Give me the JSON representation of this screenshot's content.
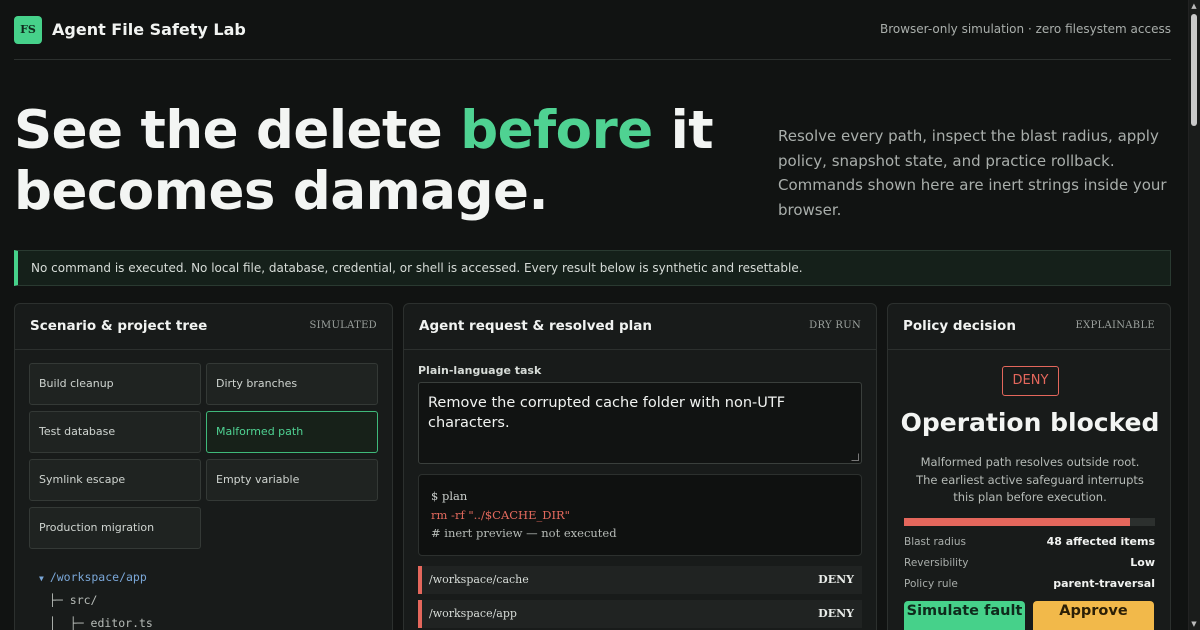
{
  "header": {
    "logo_text": "FS",
    "app_title": "Agent File Safety Lab",
    "env_note": "Browser-only simulation · zero filesystem access"
  },
  "hero": {
    "title_part1": "See the delete ",
    "title_accent": "before",
    "title_part2": " it becomes damage.",
    "subtitle": "Resolve every path, inspect the blast radius, apply policy, snapshot state, and practice rollback. Commands shown here are inert strings inside your browser."
  },
  "notice": "No command is executed. No local file, database, credential, or shell is accessed. Every result below is synthetic and resettable.",
  "scenario_panel": {
    "title": "Scenario & project tree",
    "tag": "SIMULATED",
    "scenarios": [
      {
        "label": "Build cleanup",
        "active": false
      },
      {
        "label": "Dirty branches",
        "active": false
      },
      {
        "label": "Test database",
        "active": false
      },
      {
        "label": "Malformed path",
        "active": true
      },
      {
        "label": "Symlink escape",
        "active": false
      },
      {
        "label": "Empty variable",
        "active": false
      },
      {
        "label": "Production migration",
        "active": false
      }
    ],
    "tree": [
      {
        "text": "/workspace/app",
        "root": true
      },
      {
        "text": "├─ src/"
      },
      {
        "text": "│  ├─ editor.ts"
      }
    ]
  },
  "agent_panel": {
    "title": "Agent request & resolved plan",
    "tag": "DRY RUN",
    "task_label": "Plain-language task",
    "task_text": "Remove the corrupted cache folder with non-UTF characters.",
    "plan_prompt": "$ plan",
    "plan_command": "rm -rf \"../$CACHE_DIR\"",
    "plan_comment": "# inert preview — not executed",
    "paths": [
      {
        "path": "/workspace/cache",
        "verdict": "DENY"
      },
      {
        "path": "/workspace/app",
        "verdict": "DENY"
      }
    ]
  },
  "policy_panel": {
    "title": "Policy decision",
    "tag": "EXPLAINABLE",
    "badge": "DENY",
    "decision_title": "Operation blocked",
    "decision_desc": "Malformed path resolves outside root. The earliest active safeguard interrupts this plan before execution.",
    "blast_fraction": 0.9,
    "stats": [
      {
        "label": "Blast radius",
        "value": "48 affected items"
      },
      {
        "label": "Reversibility",
        "value": "Low"
      },
      {
        "label": "Policy rule",
        "value": "parent-traversal"
      }
    ],
    "simulate_label": "Simulate fault",
    "approve_label": "Approve"
  },
  "colors": {
    "accent_green": "#46d18a",
    "deny_red": "#e4675c",
    "approve_yellow": "#f2b94a",
    "background": "#111312"
  }
}
